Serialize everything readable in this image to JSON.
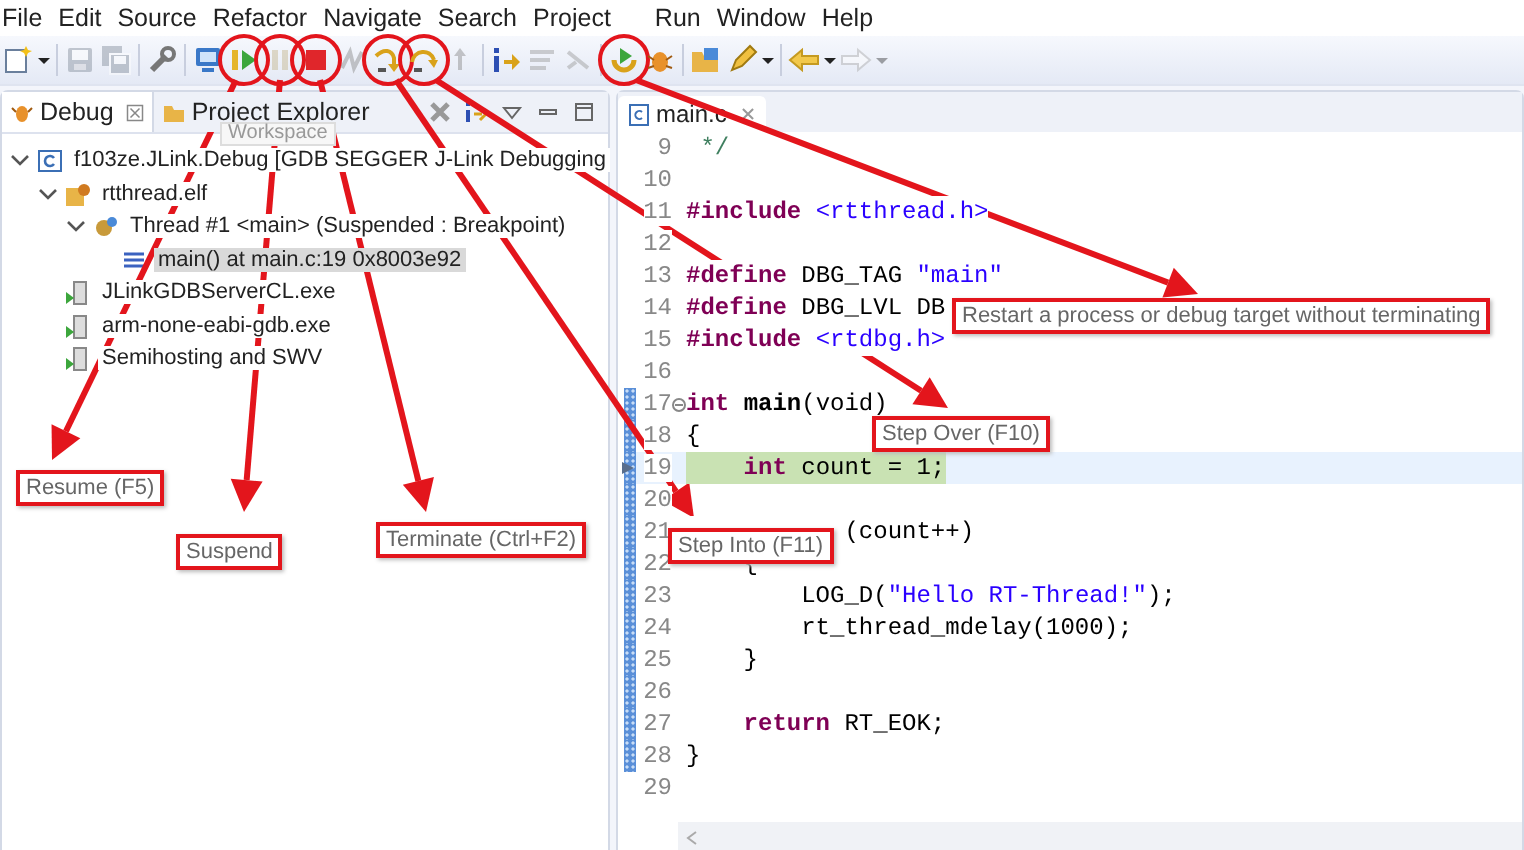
{
  "menu": [
    {
      "label": "File"
    },
    {
      "label": "Edit"
    },
    {
      "label": "Source"
    },
    {
      "label": "Refactor"
    },
    {
      "label": "Navigate"
    },
    {
      "label": "Search"
    },
    {
      "label": "Project"
    },
    {
      "label": "Run"
    },
    {
      "label": "Window"
    },
    {
      "label": "Help"
    }
  ],
  "toolbar": [
    {
      "kind": "new",
      "disabled": false,
      "circled": false
    },
    {
      "kind": "dropdown",
      "disabled": false,
      "circled": false
    },
    {
      "kind": "sep"
    },
    {
      "kind": "save",
      "disabled": true,
      "circled": false
    },
    {
      "kind": "saveall",
      "disabled": true,
      "circled": false
    },
    {
      "kind": "sep"
    },
    {
      "kind": "tool",
      "disabled": false,
      "circled": false
    },
    {
      "kind": "sep"
    },
    {
      "kind": "monitor",
      "disabled": false,
      "circled": false
    },
    {
      "kind": "resume",
      "disabled": false,
      "circled": true
    },
    {
      "kind": "suspend",
      "disabled": true,
      "circled": true
    },
    {
      "kind": "terminate",
      "disabled": false,
      "circled": true
    },
    {
      "kind": "disconnect",
      "disabled": true,
      "circled": false
    },
    {
      "kind": "stepinto",
      "disabled": false,
      "circled": true
    },
    {
      "kind": "stepover",
      "disabled": false,
      "circled": true
    },
    {
      "kind": "stepreturn",
      "disabled": true,
      "circled": false
    },
    {
      "kind": "sep"
    },
    {
      "kind": "instr",
      "disabled": false,
      "circled": false
    },
    {
      "kind": "filter",
      "disabled": true,
      "circled": false
    },
    {
      "kind": "dropframe",
      "disabled": true,
      "circled": false
    },
    {
      "kind": "sep"
    },
    {
      "kind": "restart",
      "disabled": false,
      "circled": true
    },
    {
      "kind": "bug",
      "disabled": false,
      "circled": false
    },
    {
      "kind": "sep"
    },
    {
      "kind": "folder",
      "disabled": false,
      "circled": false
    },
    {
      "kind": "pencil",
      "disabled": false,
      "circled": false
    },
    {
      "kind": "dropdown",
      "disabled": false,
      "circled": false
    },
    {
      "kind": "sep"
    },
    {
      "kind": "back",
      "disabled": false,
      "circled": false
    },
    {
      "kind": "dropdown",
      "disabled": false,
      "circled": false
    },
    {
      "kind": "forward",
      "disabled": true,
      "circled": false
    },
    {
      "kind": "dropdown",
      "disabled": true,
      "circled": false
    }
  ],
  "debug_view": {
    "tabs": [
      {
        "label": "Debug",
        "selected": true
      },
      {
        "label": "Project Explorer",
        "selected": false
      }
    ],
    "tooltip": "Workspace",
    "tree": [
      {
        "kind": "launch",
        "label": "f103ze.JLink.Debug [GDB SEGGER J-Link Debugging",
        "selected": false,
        "expanded": true,
        "children": [
          {
            "kind": "elf",
            "label": "rtthread.elf",
            "selected": false,
            "expanded": true,
            "children": [
              {
                "kind": "thread",
                "label": "Thread #1 <main> (Suspended : Breakpoint)",
                "selected": false,
                "expanded": true,
                "children": [
                  {
                    "kind": "frame",
                    "label": "main() at main.c:19 0x8003e92",
                    "selected": true
                  }
                ]
              }
            ]
          },
          {
            "kind": "process",
            "label": "JLinkGDBServerCL.exe",
            "selected": false
          },
          {
            "kind": "process",
            "label": "arm-none-eabi-gdb.exe",
            "selected": false
          },
          {
            "kind": "process",
            "label": "Semihosting and SWV",
            "selected": false
          }
        ]
      }
    ]
  },
  "editor": {
    "tab": "main.c",
    "lines": [
      {
        "number": "9",
        "range_marker": false,
        "current": false,
        "foldable": false,
        "tokens": [
          {
            "kind": "comment",
            "text": " */"
          }
        ]
      },
      {
        "number": "10",
        "range_marker": false,
        "current": false,
        "foldable": false
      },
      {
        "number": "11",
        "range_marker": false,
        "current": false,
        "foldable": false,
        "tokens": [
          {
            "kind": "directive",
            "text": "#include "
          },
          {
            "kind": "header",
            "text": "<rtthread.h>"
          }
        ]
      },
      {
        "number": "12",
        "range_marker": false,
        "current": false,
        "foldable": false
      },
      {
        "number": "13",
        "range_marker": false,
        "current": false,
        "foldable": false,
        "tokens": [
          {
            "kind": "directive",
            "text": "#define"
          },
          {
            "kind": "plain",
            "text": " DBG_TAG "
          },
          {
            "kind": "string",
            "text": "\"main\""
          }
        ]
      },
      {
        "number": "14",
        "range_marker": false,
        "current": false,
        "foldable": false,
        "tokens": [
          {
            "kind": "directive",
            "text": "#define"
          },
          {
            "kind": "plain",
            "text": " DBG_LVL DB"
          }
        ]
      },
      {
        "number": "15",
        "range_marker": false,
        "current": false,
        "foldable": false,
        "tokens": [
          {
            "kind": "directive",
            "text": "#include "
          },
          {
            "kind": "header",
            "text": "<rtdbg.h>"
          }
        ]
      },
      {
        "number": "16",
        "range_marker": false,
        "current": false,
        "foldable": false
      },
      {
        "number": "17",
        "range_marker": true,
        "current": false,
        "foldable": true,
        "tokens": [
          {
            "kind": "keyword",
            "text": "int "
          },
          {
            "kind": "function",
            "text": "main"
          },
          {
            "kind": "plain",
            "text": "(void)"
          }
        ]
      },
      {
        "number": "18",
        "range_marker": true,
        "current": false,
        "foldable": false,
        "tokens": [
          {
            "kind": "plain",
            "text": "{"
          }
        ]
      },
      {
        "number": "19",
        "range_marker": true,
        "current": true,
        "foldable": false,
        "tokens": [
          {
            "kind": "keyword",
            "text": "    int"
          },
          {
            "kind": "plain",
            "text": " count = 1;"
          }
        ]
      },
      {
        "number": "20",
        "range_marker": true,
        "current": false,
        "foldable": false
      },
      {
        "number": "21",
        "range_marker": true,
        "current": false,
        "foldable": false,
        "tokens": [
          {
            "kind": "plain",
            "text": "           (count++)"
          }
        ]
      },
      {
        "number": "22",
        "range_marker": true,
        "current": false,
        "foldable": false,
        "tokens": [
          {
            "kind": "plain",
            "text": "    {"
          }
        ]
      },
      {
        "number": "23",
        "range_marker": true,
        "current": false,
        "foldable": false,
        "tokens": [
          {
            "kind": "plain",
            "text": "        LOG_D("
          },
          {
            "kind": "string",
            "text": "\"Hello RT-Thread!\""
          },
          {
            "kind": "plain",
            "text": ");"
          }
        ]
      },
      {
        "number": "24",
        "range_marker": true,
        "current": false,
        "foldable": false,
        "tokens": [
          {
            "kind": "plain",
            "text": "        rt_thread_mdelay(1000);"
          }
        ]
      },
      {
        "number": "25",
        "range_marker": true,
        "current": false,
        "foldable": false,
        "tokens": [
          {
            "kind": "plain",
            "text": "    }"
          }
        ]
      },
      {
        "number": "26",
        "range_marker": true,
        "current": false,
        "foldable": false
      },
      {
        "number": "27",
        "range_marker": true,
        "current": false,
        "foldable": false,
        "tokens": [
          {
            "kind": "keyword",
            "text": "    return"
          },
          {
            "kind": "plain",
            "text": " RT_EOK;"
          }
        ]
      },
      {
        "number": "28",
        "range_marker": true,
        "current": false,
        "foldable": false,
        "tokens": [
          {
            "kind": "plain",
            "text": "}"
          }
        ]
      },
      {
        "number": "29",
        "range_marker": false,
        "current": false,
        "foldable": false
      }
    ]
  },
  "callouts": [
    {
      "text": "Resume (F5)"
    },
    {
      "text": "Suspend"
    },
    {
      "text": "Terminate (Ctrl+F2)"
    },
    {
      "text": "Step Into (F11)"
    },
    {
      "text": "Step Over (F10)"
    },
    {
      "text": "Restart a process or debug target without terminating"
    }
  ]
}
